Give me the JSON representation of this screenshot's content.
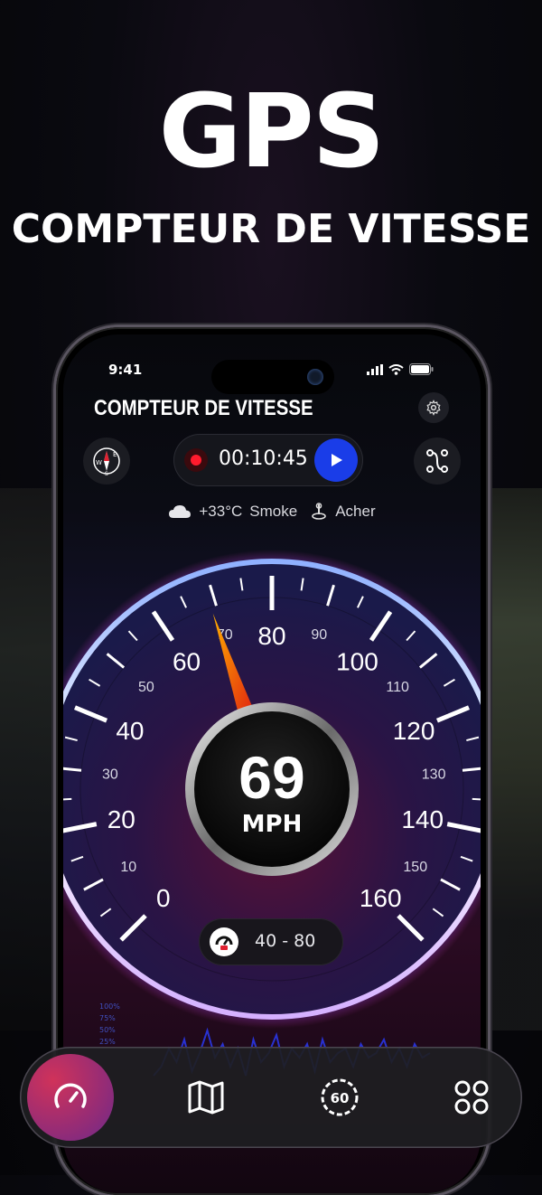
{
  "promo": {
    "title": "GPS",
    "subtitle": "COMPTEUR DE VITESSE"
  },
  "status_bar": {
    "time": "9:41",
    "icons": [
      "signal-icon",
      "wifi-icon",
      "battery-icon"
    ]
  },
  "header": {
    "title": "COMPTEUR DE VITESSE",
    "settings_icon": "gear-icon"
  },
  "trip": {
    "elapsed_time": "00:10:45",
    "record_icon": "record-icon",
    "play_icon": "play-icon",
    "compass_icon": "compass-icon",
    "route_icon": "route-icon"
  },
  "weather": {
    "temperature": "+33°C",
    "condition": "Smoke",
    "location": "Acher"
  },
  "speedometer": {
    "speed": "69",
    "unit": "MPH",
    "major_labels": [
      "0",
      "20",
      "40",
      "60",
      "80",
      "100",
      "120",
      "140",
      "160"
    ],
    "minor_labels": [
      "10",
      "30",
      "50",
      "70",
      "90",
      "110",
      "130",
      "150"
    ],
    "needle_value": 69,
    "max": 160
  },
  "speed_limit": {
    "range": "40 - 80"
  },
  "graph_labels": [
    "100%",
    "75%",
    "50%",
    "25%"
  ],
  "bottom_nav": {
    "items": [
      {
        "icon": "speedometer-icon",
        "active": true
      },
      {
        "icon": "map-icon",
        "active": false
      },
      {
        "icon": "speed-limit-icon",
        "label": "60",
        "active": false
      },
      {
        "icon": "grid-icon",
        "active": false
      }
    ]
  },
  "colors": {
    "accent_blue": "#1a3de8",
    "record_red": "#ff1b2d",
    "needle": "#ff5a1a",
    "nav_active_start": "#d0325a",
    "nav_active_end": "#6b2b8c"
  }
}
